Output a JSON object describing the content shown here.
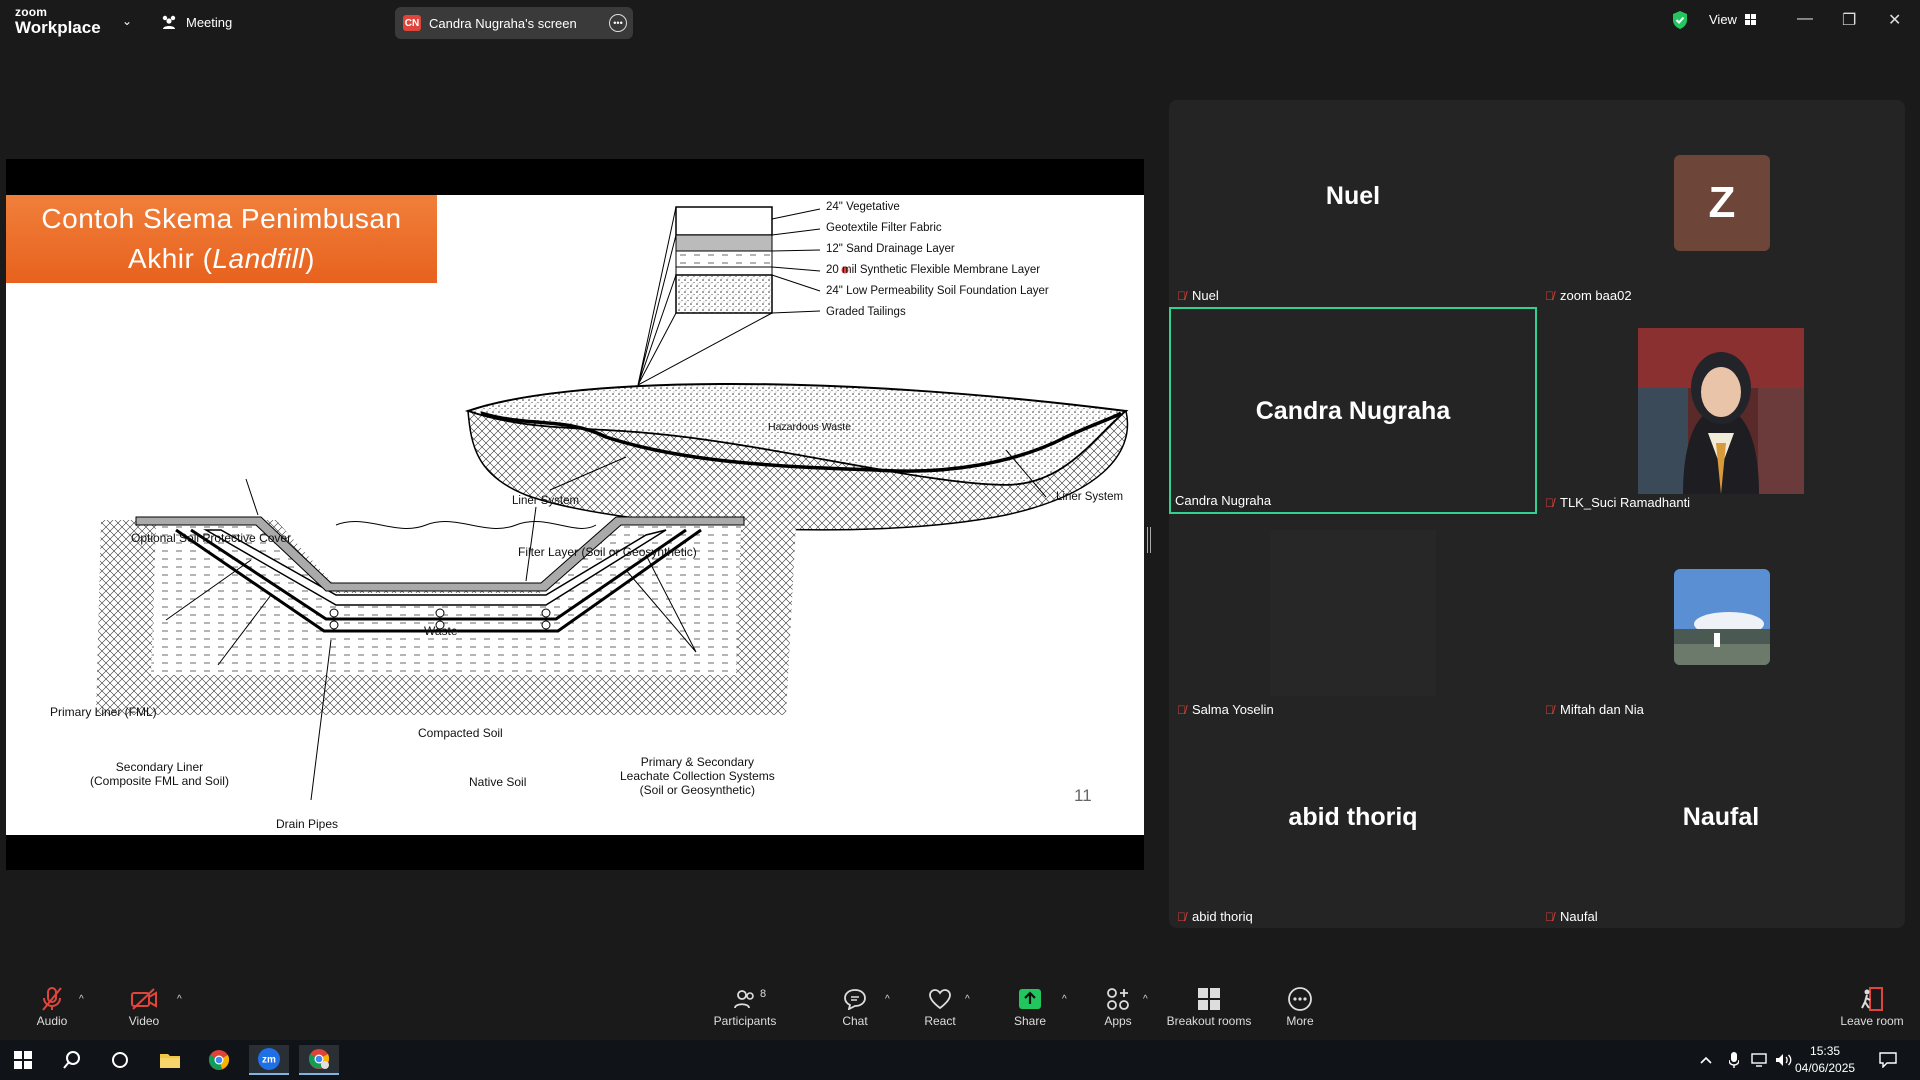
{
  "app": {
    "logo_line1": "zoom",
    "logo_line2": "Workplace",
    "meeting_label": "Meeting",
    "screen_tab": {
      "badge": "CN",
      "label": "Candra Nugraha's screen"
    },
    "view_label": "View"
  },
  "slide": {
    "title_line1": "Contoh Skema Penimbusan",
    "title_line2_prefix": "Akhir (",
    "title_line2_italic": "Landfill",
    "title_line2_suffix": ")",
    "page_number": "11",
    "layers": [
      "24\" Vegetative",
      "Geotextile Filter Fabric",
      "12\" Sand Drainage Layer",
      "20 mil Synthetic Flexible Membrane Layer",
      "24\" Low Permeability Soil Foundation Layer",
      "Graded Tailings"
    ],
    "labels": {
      "hazardous_waste": "Hazardous Waste",
      "liner_system_left": "Liner System",
      "liner_system_right": "Liner System",
      "optional_cover": "Optional Soil Protective Cover",
      "filter_layer": "Filter Layer (Soil or Geosynthetic)",
      "waste": "Waste",
      "primary_liner": "Primary Liner (FML)",
      "secondary_liner_1": "Secondary Liner",
      "secondary_liner_2": "(Composite FML and Soil)",
      "compacted_soil": "Compacted Soil",
      "native_soil": "Native Soil",
      "leachate_1": "Primary & Secondary",
      "leachate_2": "Leachate Collection Systems",
      "leachate_3": "(Soil or Geosynthetic)",
      "drain_pipes": "Drain Pipes"
    }
  },
  "participants": [
    {
      "display": "Nuel",
      "label": "Nuel"
    },
    {
      "avatar_letter": "Z",
      "label": "zoom baa02"
    },
    {
      "display": "Candra Nugraha",
      "label": "Candra Nugraha"
    },
    {
      "label": "TLK_Suci Ramadhanti"
    },
    {
      "label": "Salma Yoselin"
    },
    {
      "label": "Miftah dan Nia"
    },
    {
      "display": "abid thoriq",
      "label": "abid thoriq"
    },
    {
      "display": "Naufal",
      "label": "Naufal"
    }
  ],
  "toolbar": {
    "audio": "Audio",
    "video": "Video",
    "participants": "Participants",
    "participants_count": "8",
    "chat": "Chat",
    "react": "React",
    "share": "Share",
    "apps": "Apps",
    "breakout": "Breakout rooms",
    "more": "More",
    "leave": "Leave room"
  },
  "taskbar": {
    "time": "15:35",
    "date": "04/06/2025"
  },
  "colors": {
    "active_border": "#2fd38f",
    "share_green": "#22c55e",
    "muted_red": "#e0453c",
    "title_orange": "#e7621e"
  }
}
